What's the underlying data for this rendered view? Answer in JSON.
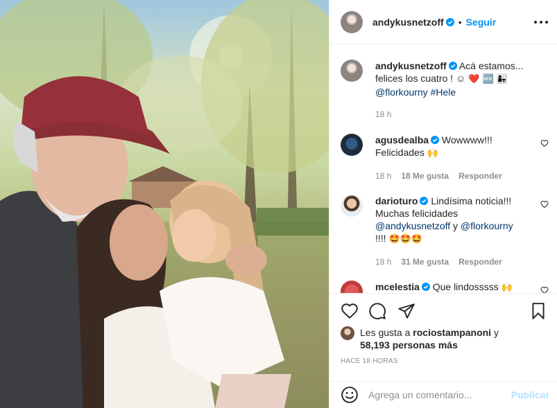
{
  "colors": {
    "accent": "#0095f6",
    "text": "#262626",
    "secondary": "#8e8e8e",
    "border": "#efefef",
    "like": "#ed4956"
  },
  "photo": {
    "description_icon": "post-photo"
  },
  "header": {
    "username": "andykusnetzoff",
    "separator": "•",
    "follow_label": "Seguir"
  },
  "caption": {
    "username": "andykusnetzoff",
    "text_line1": "Acá estamos...",
    "text_line2": "felices los cuatro ! ☺",
    "emojis": "❤️ 🆕 👩‍👧",
    "mention": "@florkourny",
    "hashtag": "#Hele",
    "time": "18 h"
  },
  "comments": [
    {
      "username": "agusdealba",
      "text": "Wowwww!!! Felicidades",
      "emoji": "🙌",
      "time": "18 h",
      "likes": "18 Me gusta",
      "reply": "Responder"
    },
    {
      "username": "darioturo",
      "text_line1": "Lindísima noticia!!!",
      "text_line2": "Muchas felicidades",
      "mention1": "@andykusnetzoff",
      "joiner": "y",
      "mention2": "@flor​kourny",
      "text_line4": "!!!!",
      "emoji": "🤩🤩🤩",
      "time": "18 h",
      "likes": "31 Me gusta",
      "reply": "Responder"
    },
    {
      "username": "mcelestia",
      "text": "Que lindosssss",
      "emoji": "🙌"
    }
  ],
  "actions": {
    "icons": [
      "heart-icon",
      "comment-icon",
      "share-icon",
      "bookmark-icon"
    ],
    "likes_prefix": "Les gusta a",
    "likes_user": "rociostampanoni",
    "likes_joiner": "y",
    "likes_count": "58,193 personas más",
    "timestamp": "HACE 18 HORAS"
  },
  "add_comment": {
    "placeholder": "Agrega un comentario...",
    "publish_label": "Publicar"
  }
}
